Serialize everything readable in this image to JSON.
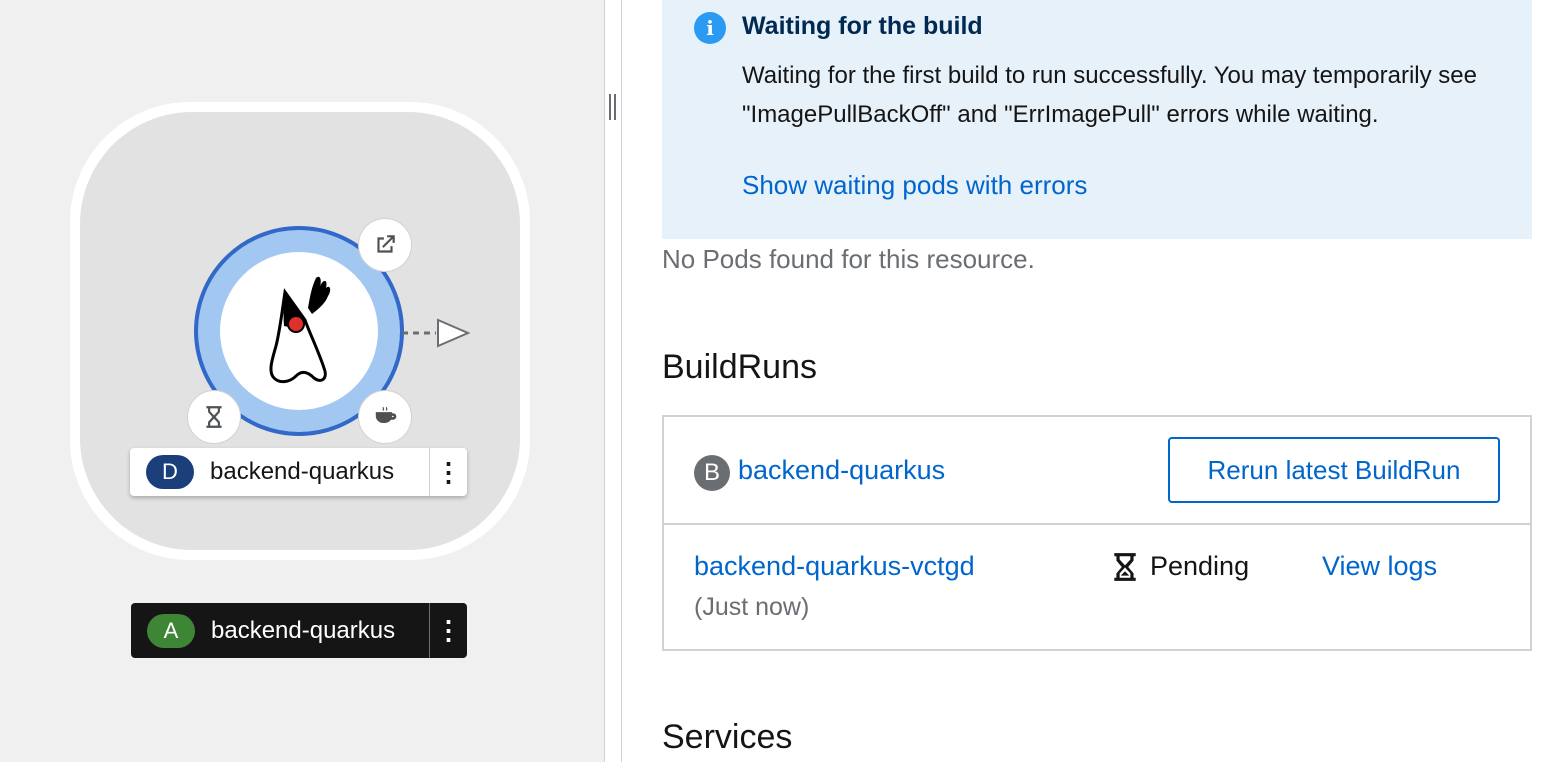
{
  "topology": {
    "node_label": {
      "badge": "D",
      "name": "backend-quarkus"
    },
    "app_label": {
      "badge": "A",
      "name": "backend-quarkus"
    },
    "icons": {
      "open_url": "external-link-icon",
      "build_status": "hourglass-icon",
      "runtime": "java-cup-icon",
      "node_image": "java-duke-icon"
    }
  },
  "alert": {
    "title": "Waiting for the build",
    "body": "Waiting for the first build to run successfully. You may temporarily see \"ImagePullBackOff\" and \"ErrImagePull\" errors while waiting.",
    "link": "Show waiting pods with errors",
    "icon": "info-icon"
  },
  "pods": {
    "empty_text": "No Pods found for this resource."
  },
  "buildruns": {
    "title": "BuildRuns",
    "build": {
      "badge": "B",
      "name": "backend-quarkus"
    },
    "rerun_label": "Rerun latest BuildRun",
    "runs": [
      {
        "name": "backend-quarkus-vctgd",
        "time": "(Just now)",
        "status": "Pending",
        "logs": "View logs"
      }
    ]
  },
  "services": {
    "title": "Services"
  },
  "colors": {
    "link": "#0066cc",
    "alert_bg": "#e7f1fa",
    "node_ring": "#a2c8f2",
    "app_badge": "#3e8635",
    "deploy_badge": "#1a3f7a"
  }
}
